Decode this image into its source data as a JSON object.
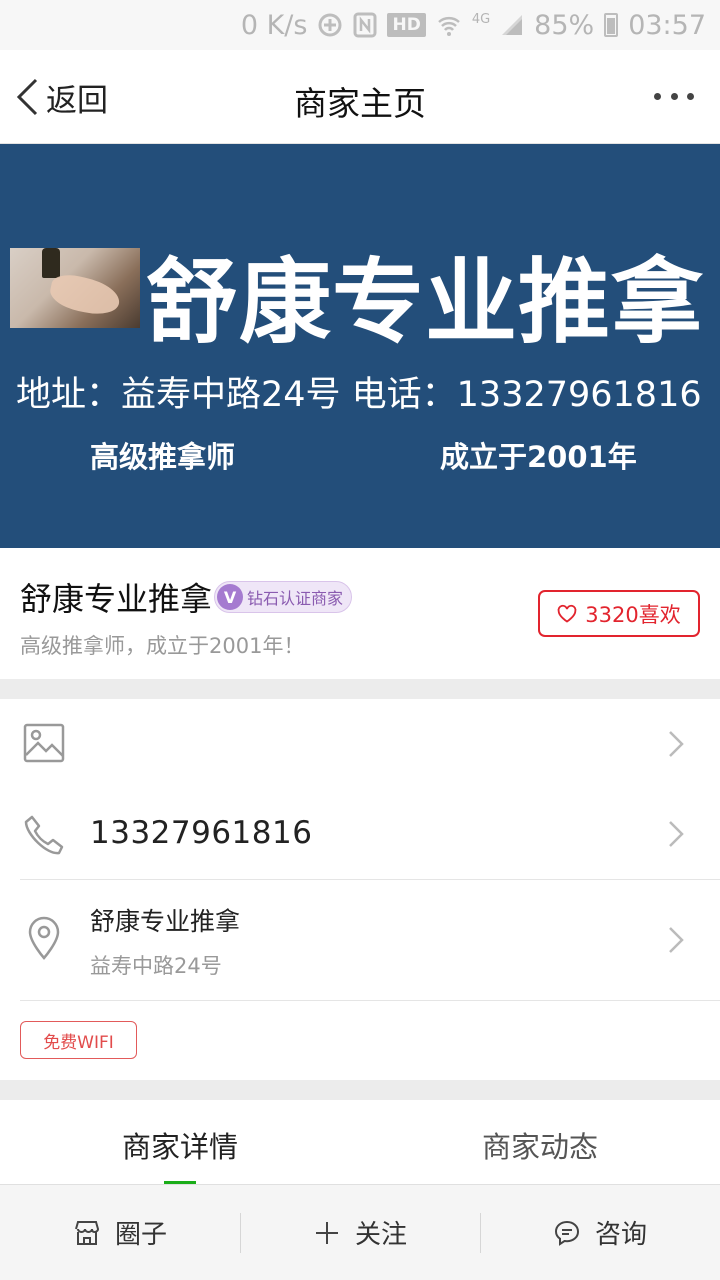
{
  "status_bar": {
    "net_speed": "0 K/s",
    "hd": "HD",
    "network": "4G",
    "battery": "85%",
    "time": "03:57"
  },
  "nav": {
    "back_label": "返回",
    "title": "商家主页"
  },
  "banner": {
    "title": "舒康专业推拿",
    "info": "地址：益寿中路24号  电话：13327961816",
    "tag_left": "高级推拿师",
    "tag_right": "成立于2001年"
  },
  "merchant": {
    "name": "舒康专业推拿",
    "badge_v": "V",
    "badge_label": "钻石认证商家",
    "subtitle": "高级推拿师，成立于2001年！",
    "likes_label": "3320喜欢",
    "like_color": "#e2242e"
  },
  "info": {
    "phone": "13327961816",
    "address_name": "舒康专业推拿",
    "address_detail": "益寿中路24号",
    "wifi_tag": "免费WIFI"
  },
  "tabs": [
    {
      "label": "商家详情",
      "active": true
    },
    {
      "label": "商家动态",
      "active": false
    }
  ],
  "bottom_bar": {
    "circle_label": "圈子",
    "follow_label": "关注",
    "consult_label": "咨询"
  },
  "colors": {
    "banner_bg": "#234e7a",
    "accent_green": "#1aad19",
    "accent_red": "#e2242e"
  }
}
